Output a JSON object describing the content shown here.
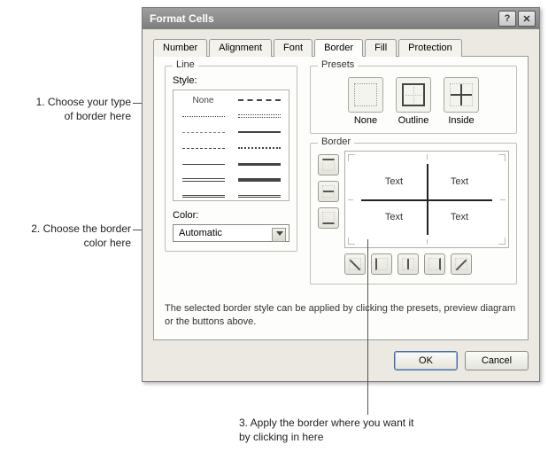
{
  "window": {
    "title": "Format Cells",
    "help_label": "?",
    "close_label": "✕"
  },
  "tabs": {
    "number": "Number",
    "alignment": "Alignment",
    "font": "Font",
    "border": "Border",
    "fill": "Fill",
    "protection": "Protection"
  },
  "line_group": {
    "title": "Line",
    "style_label": "Style:",
    "none_label": "None",
    "color_label": "Color:",
    "color_value": "Automatic"
  },
  "presets_group": {
    "title": "Presets",
    "none": "None",
    "outline": "Outline",
    "inside": "Inside"
  },
  "border_group": {
    "title": "Border",
    "cell_text": "Text"
  },
  "help_text": "The selected border style can be applied by clicking the presets, preview diagram or the buttons above.",
  "buttons": {
    "ok": "OK",
    "cancel": "Cancel"
  },
  "annotations": {
    "a1_l1": "1. Choose your type",
    "a1_l2": "of border here",
    "a2_l1": "2. Choose the border",
    "a2_l2": "color here",
    "a3_l1": "3. Apply the border where you want it",
    "a3_l2": "by clicking in here"
  }
}
